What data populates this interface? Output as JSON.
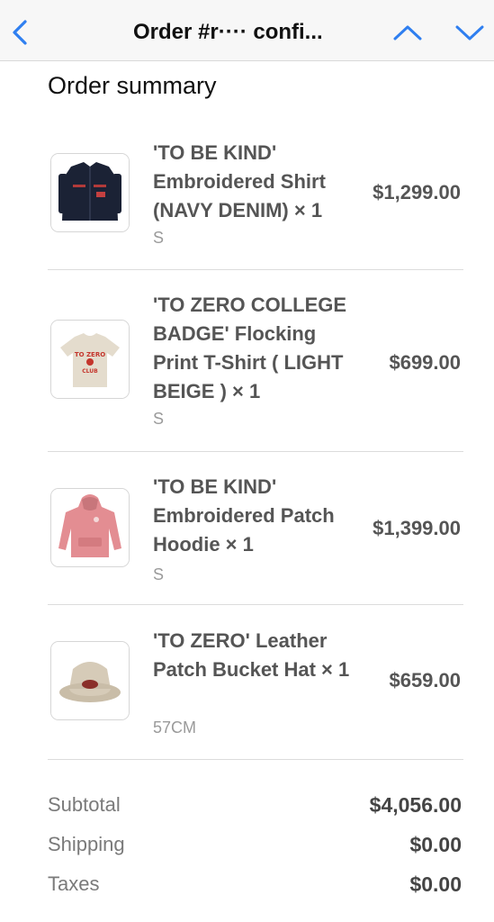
{
  "navbar": {
    "title": "Order #r···· confi...",
    "back_icon": "chevron-left-icon",
    "up_icon": "chevron-up-icon",
    "down_icon": "chevron-down-icon",
    "accent_color": "#2f7ff0"
  },
  "summary": {
    "title": "Order summary",
    "items": [
      {
        "name": "'TO BE KIND' Embroidered Shirt (NAVY DENIM) × 1",
        "variant": "S",
        "price": "$1,299.00",
        "image": "navy-shirt-image"
      },
      {
        "name": "'TO ZERO COLLEGE BADGE' Flocking Print T-Shirt ( LIGHT BEIGE ) × 1",
        "variant": "S",
        "price": "$699.00",
        "image": "beige-tshirt-image"
      },
      {
        "name": "'TO BE KIND' Embroidered Patch Hoodie × 1",
        "variant": "S",
        "price": "$1,399.00",
        "image": "pink-hoodie-image"
      },
      {
        "name": "'TO ZERO' Leather Patch Bucket Hat × 1",
        "variant": "57CM",
        "price": "$659.00",
        "image": "bucket-hat-image"
      }
    ]
  },
  "totals": {
    "subtotal_label": "Subtotal",
    "subtotal_value": "$4,056.00",
    "shipping_label": "Shipping",
    "shipping_value": "$0.00",
    "taxes_label": "Taxes",
    "taxes_value": "$0.00"
  }
}
